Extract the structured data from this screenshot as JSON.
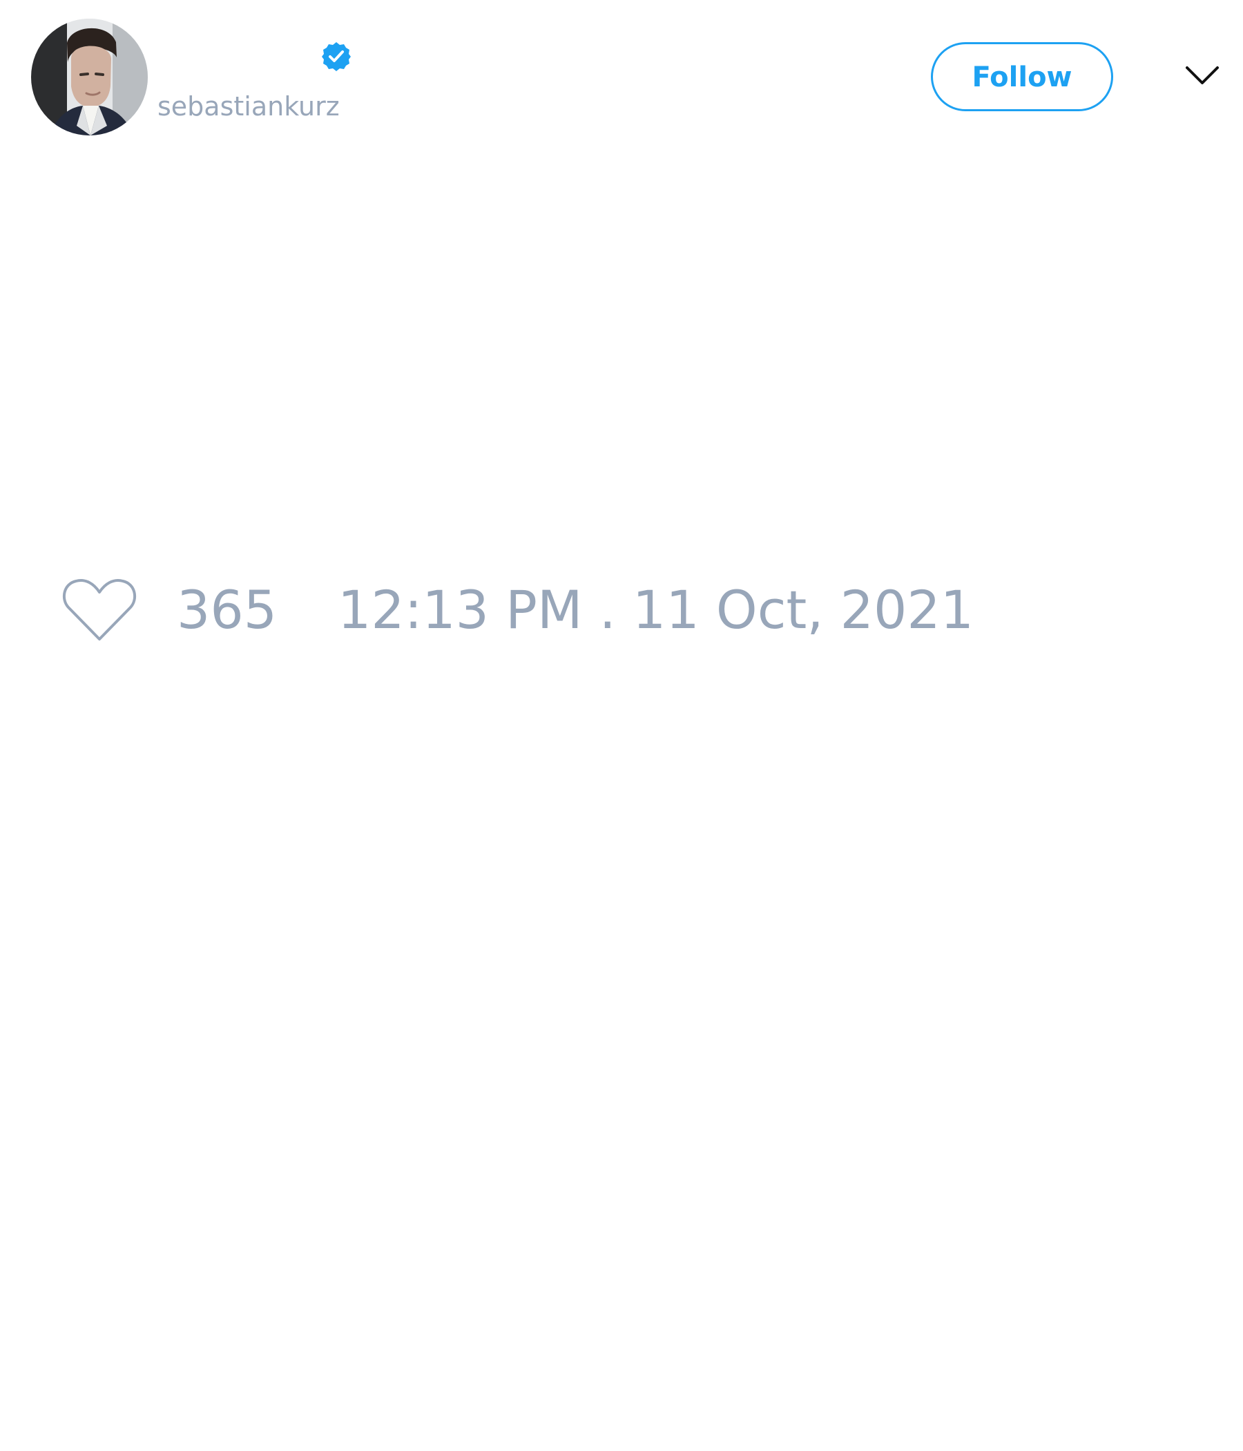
{
  "tweet": {
    "author": {
      "display_name": "",
      "handle": "sebastiankurz",
      "verified": true,
      "avatar_icon": "profile-photo-avatar"
    },
    "actions": {
      "follow_label": "Follow",
      "menu_icon": "chevron-down-icon"
    },
    "content": {
      "text": ""
    },
    "stats": {
      "like_icon": "heart-outline-icon",
      "likes": "365",
      "timestamp": "12:13 PM . 11 Oct, 2021"
    }
  },
  "colors": {
    "accent": "#1da1f2",
    "muted_text": "#98a6b9",
    "background": "#ffffff"
  }
}
